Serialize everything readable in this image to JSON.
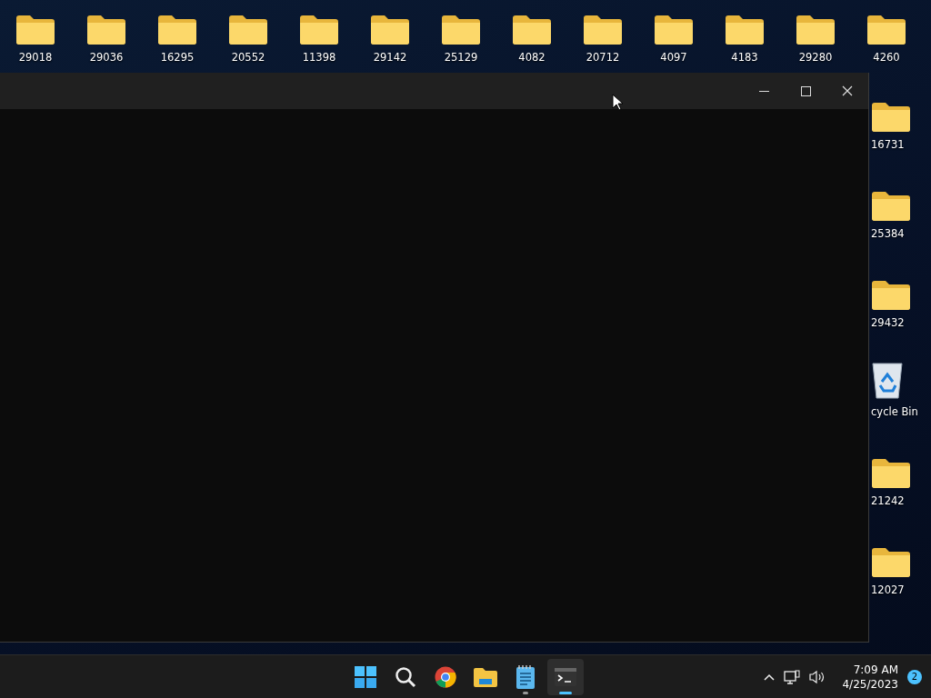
{
  "desktop_top": [
    {
      "label": "29018",
      "kind": "folder"
    },
    {
      "label": "29036",
      "kind": "folder"
    },
    {
      "label": "16295",
      "kind": "folder"
    },
    {
      "label": "20552",
      "kind": "folder"
    },
    {
      "label": "11398",
      "kind": "folder"
    },
    {
      "label": "29142",
      "kind": "folder"
    },
    {
      "label": "25129",
      "kind": "folder"
    },
    {
      "label": "4082",
      "kind": "folder"
    },
    {
      "label": "20712",
      "kind": "folder"
    },
    {
      "label": "4097",
      "kind": "folder"
    },
    {
      "label": "4183",
      "kind": "folder"
    },
    {
      "label": "29280",
      "kind": "folder"
    },
    {
      "label": "4260",
      "kind": "folder"
    }
  ],
  "desktop_right": [
    {
      "label": "16731",
      "kind": "folder"
    },
    {
      "label": "25384",
      "kind": "folder"
    },
    {
      "label": "29432",
      "kind": "folder"
    },
    {
      "label": "cycle Bin",
      "kind": "recycle-bin"
    },
    {
      "label": "21242",
      "kind": "folder"
    },
    {
      "label": "12027",
      "kind": "folder"
    }
  ],
  "taskbar": {
    "apps": [
      {
        "kind": "start",
        "running": false,
        "selected": false
      },
      {
        "kind": "search",
        "running": false,
        "selected": false
      },
      {
        "kind": "browser",
        "running": false,
        "selected": false
      },
      {
        "kind": "files",
        "running": false,
        "selected": false
      },
      {
        "kind": "notepad",
        "running": true,
        "selected": false
      },
      {
        "kind": "terminal",
        "running": true,
        "selected": true
      }
    ],
    "time": "7:09 AM",
    "date": "4/25/2023",
    "notification_count": "2"
  }
}
